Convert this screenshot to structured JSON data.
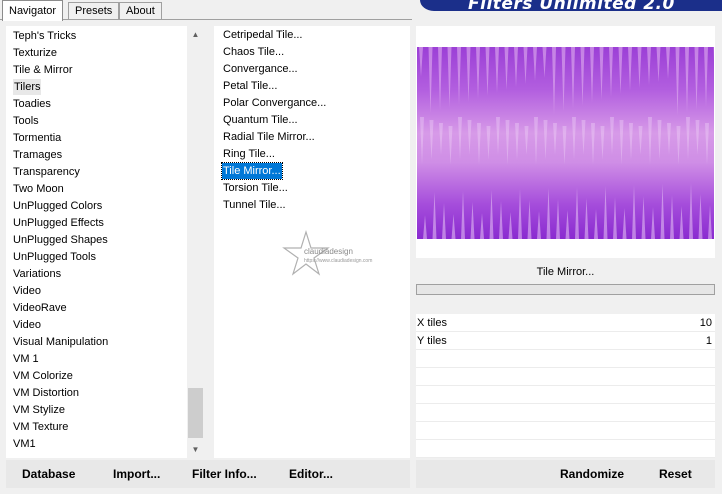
{
  "tabs": [
    {
      "label": "Navigator"
    },
    {
      "label": "Presets"
    },
    {
      "label": "About"
    }
  ],
  "brand": {
    "title": "Filters Unlimited 2.0"
  },
  "categories": [
    "Teph's Tricks",
    "Texturize",
    "Tile & Mirror",
    "Tilers",
    "Toadies",
    "Tools",
    "Tormentia",
    "Tramages",
    "Transparency",
    "Two Moon",
    "UnPlugged Colors",
    "UnPlugged Effects",
    "UnPlugged Shapes",
    "UnPlugged Tools",
    "Variations",
    "Video",
    "VideoRave",
    "Video",
    "Visual Manipulation",
    "VM 1",
    "VM Colorize",
    "VM Distortion",
    "VM Stylize",
    "VM Texture",
    "VM1"
  ],
  "selected_category": "Tilers",
  "filters": [
    "Cetripedal Tile...",
    "Chaos Tile...",
    "Convergance...",
    "Petal Tile...",
    "Polar Convergance...",
    "Quantum Tile...",
    "Radial Tile Mirror...",
    "Ring Tile...",
    "Tile Mirror...",
    "Torsion Tile...",
    "Tunnel Tile..."
  ],
  "selected_filter": "Tile Mirror...",
  "filter_title": "Tile Mirror...",
  "progress": 0,
  "params": [
    {
      "label": "X tiles",
      "value": "10"
    },
    {
      "label": "Y tiles",
      "value": "1"
    }
  ],
  "watermark": {
    "text": "claudiadesign",
    "url": "https://www.claudiadesign.com"
  },
  "buttons": {
    "database": "Database",
    "import": "Import...",
    "filter_info": "Filter Info...",
    "editor": "Editor...",
    "randomize": "Randomize",
    "reset": "Reset"
  },
  "colors": {
    "selection": "#0078d7",
    "preview_dark": "#8a2bd0",
    "preview_light": "#d79ae8"
  }
}
